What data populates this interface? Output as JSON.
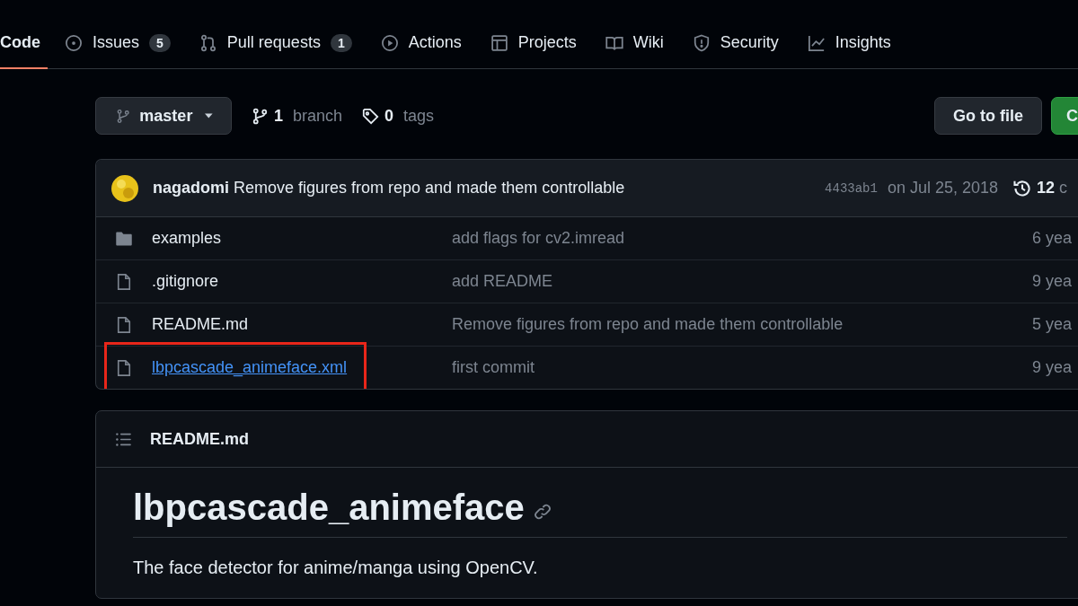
{
  "tabs": [
    {
      "label": "Code",
      "selected": true
    },
    {
      "label": "Issues",
      "count": "5",
      "selected": false
    },
    {
      "label": "Pull requests",
      "count": "1",
      "selected": false
    },
    {
      "label": "Actions",
      "selected": false
    },
    {
      "label": "Projects",
      "selected": false
    },
    {
      "label": "Wiki",
      "selected": false
    },
    {
      "label": "Security",
      "selected": false
    },
    {
      "label": "Insights",
      "selected": false
    }
  ],
  "branch_selector": {
    "label": "master"
  },
  "branch_count": {
    "number": "1",
    "label": "branch"
  },
  "tag_count": {
    "number": "0",
    "label": "tags"
  },
  "go_to_file": "Go to file",
  "code_button": "C",
  "latest_commit": {
    "author": "nagadomi",
    "message": "Remove figures from repo and made them controllable",
    "sha": "4433ab1",
    "date": "on Jul 25, 2018",
    "commits": "12",
    "commits_label": "c"
  },
  "files": [
    {
      "kind": "folder",
      "name": "examples",
      "message": "add flags for cv2.imread",
      "age": "6 yea",
      "highlighted": false
    },
    {
      "kind": "file",
      "name": ".gitignore",
      "message": "add README",
      "age": "9 yea",
      "highlighted": false
    },
    {
      "kind": "file",
      "name": "README.md",
      "message": "Remove figures from repo and made them controllable",
      "age": "5 yea",
      "highlighted": false
    },
    {
      "kind": "file",
      "name": "lbpcascade_animeface.xml",
      "message": "first commit",
      "age": "9 yea",
      "highlighted": true
    }
  ],
  "readme": {
    "filename": "README.md",
    "heading": "lbpcascade_animeface",
    "text": "The face detector for anime/manga using OpenCV."
  }
}
